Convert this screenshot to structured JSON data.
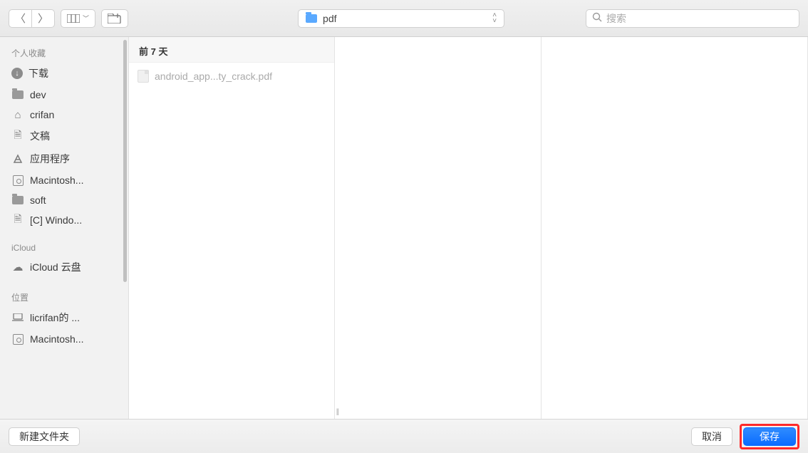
{
  "toolbar": {
    "current_folder": "pdf",
    "search_placeholder": "搜索"
  },
  "sidebar": {
    "sections": [
      {
        "header": "个人收藏",
        "items": [
          {
            "icon": "download",
            "label": "下载"
          },
          {
            "icon": "folder",
            "label": "dev"
          },
          {
            "icon": "home",
            "label": "crifan"
          },
          {
            "icon": "doc",
            "label": "文稿"
          },
          {
            "icon": "app",
            "label": "应用程序"
          },
          {
            "icon": "disk",
            "label": "Macintosh..."
          },
          {
            "icon": "folder",
            "label": "soft"
          },
          {
            "icon": "doc",
            "label": "[C] Windo..."
          }
        ]
      },
      {
        "header": "iCloud",
        "items": [
          {
            "icon": "cloud",
            "label": "iCloud 云盘"
          }
        ]
      },
      {
        "header": "位置",
        "items": [
          {
            "icon": "laptop",
            "label": "licrifan的 ..."
          },
          {
            "icon": "disk",
            "label": "Macintosh..."
          }
        ]
      }
    ]
  },
  "column1": {
    "group_header": "前 7 天",
    "files": [
      {
        "name": "android_app...ty_crack.pdf"
      }
    ]
  },
  "footer": {
    "new_folder": "新建文件夹",
    "cancel": "取消",
    "save": "保存"
  }
}
